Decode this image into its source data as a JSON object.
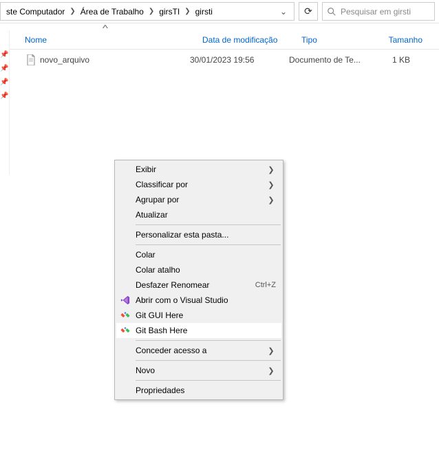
{
  "breadcrumb": {
    "items": [
      "ste Computador",
      "Área de Trabalho",
      "girsTI",
      "girsti"
    ]
  },
  "search": {
    "placeholder": "Pesquisar em girsti"
  },
  "columns": {
    "name": "Nome",
    "date": "Data de modificação",
    "type": "Tipo",
    "size": "Tamanho"
  },
  "files": [
    {
      "name": "novo_arquivo",
      "date": "30/01/2023 19:56",
      "type": "Documento de Te...",
      "size": "1 KB"
    }
  ],
  "context_menu": {
    "view": "Exibir",
    "sort_by": "Classificar por",
    "group_by": "Agrupar por",
    "refresh": "Atualizar",
    "customize": "Personalizar esta pasta...",
    "paste": "Colar",
    "paste_shortcut": "Colar atalho",
    "undo_rename": "Desfazer Renomear",
    "undo_shortcut": "Ctrl+Z",
    "open_vs": "Abrir com o Visual Studio",
    "git_gui": "Git GUI Here",
    "git_bash": "Git Bash Here",
    "grant_access": "Conceder acesso a",
    "new": "Novo",
    "properties": "Propriedades"
  }
}
